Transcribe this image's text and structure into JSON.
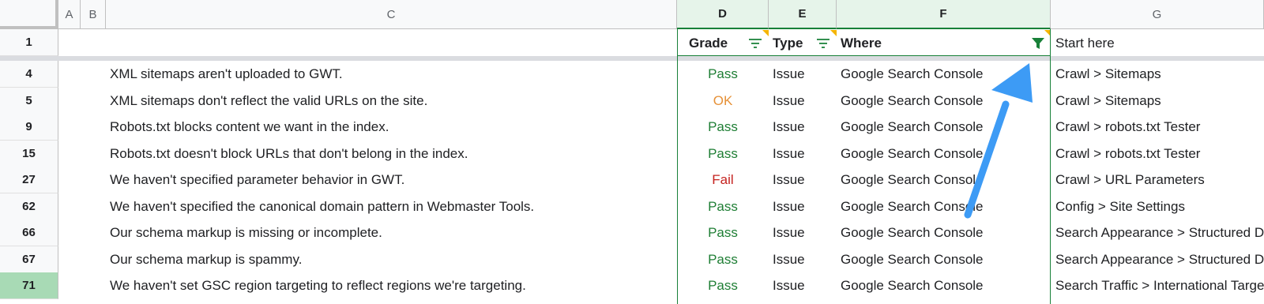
{
  "columns": [
    "A",
    "B",
    "C",
    "D",
    "E",
    "F",
    "G"
  ],
  "header_row": {
    "row_number": "1",
    "grade": "Grade",
    "type": "Type",
    "where": "Where",
    "start": "Start here"
  },
  "rows": [
    {
      "num": "4",
      "issue": "XML sitemaps aren't uploaded to GWT.",
      "grade": "Pass",
      "type": "Issue",
      "where": "Google Search Console",
      "start": "Crawl > Sitemaps"
    },
    {
      "num": "5",
      "issue": "XML sitemaps don't reflect the valid URLs on the site.",
      "grade": "OK",
      "type": "Issue",
      "where": "Google Search Console",
      "start": "Crawl > Sitemaps"
    },
    {
      "num": "9",
      "issue": "Robots.txt blocks content we want in the index.",
      "grade": "Pass",
      "type": "Issue",
      "where": "Google Search Console",
      "start": "Crawl > robots.txt Tester"
    },
    {
      "num": "15",
      "issue": "Robots.txt doesn't block URLs that don't belong in the index.",
      "grade": "Pass",
      "type": "Issue",
      "where": "Google Search Console",
      "start": "Crawl > robots.txt Tester"
    },
    {
      "num": "27",
      "issue": "We haven't specified parameter behavior in GWT.",
      "grade": "Fail",
      "type": "Issue",
      "where": "Google Search Console",
      "start": "Crawl > URL Parameters"
    },
    {
      "num": "62",
      "issue": "We haven't specified the canonical domain pattern in Webmaster Tools.",
      "grade": "Pass",
      "type": "Issue",
      "where": "Google Search Console",
      "start": "Config > Site Settings"
    },
    {
      "num": "66",
      "issue": "Our schema markup is missing or incomplete.",
      "grade": "Pass",
      "type": "Issue",
      "where": "Google Search Console",
      "start": "Search Appearance > Structured Data"
    },
    {
      "num": "67",
      "issue": "Our schema markup is spammy.",
      "grade": "Pass",
      "type": "Issue",
      "where": "Google Search Console",
      "start": "Search Appearance > Structured Data"
    },
    {
      "num": "71",
      "issue": "We haven't set GSC region targeting to reflect regions we're targeting.",
      "grade": "Pass",
      "type": "Issue",
      "where": "Google Search Console",
      "start": "Search Traffic > International Targeting"
    }
  ],
  "colors": {
    "pass": "#1e7e34",
    "ok": "#e69138",
    "fail": "#c5221f",
    "selection_green": "#188038",
    "arrow_blue": "#3d9bf5",
    "filter_icon": "#188038"
  },
  "icons": {
    "grade_filter": "filter-lines-icon",
    "type_filter": "filter-lines-icon",
    "where_filter": "filter-funnel-active-icon"
  }
}
